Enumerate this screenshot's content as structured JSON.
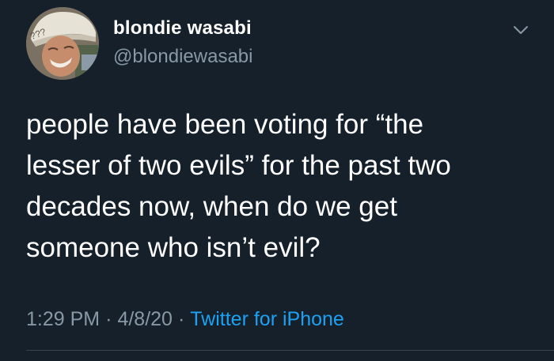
{
  "author": {
    "display_name": "blondie wasabi",
    "handle": "@blondiewasabi",
    "avatar_overlay_text": "???"
  },
  "tweet": {
    "text_lines": [
      "people have been voting for “the",
      "lesser of two evils” for the past two",
      "decades now, when do we get",
      "someone who isn’t evil?"
    ],
    "time": "1:29 PM",
    "separator": "·",
    "date": "4/8/20",
    "source": "Twitter for iPhone"
  },
  "icons": {
    "menu": "chevron-down-icon"
  },
  "colors": {
    "background": "#15202b",
    "primary_text": "#ffffff",
    "secondary_text": "#8899a6",
    "link": "#1da1f2",
    "divider": "#38444d"
  }
}
